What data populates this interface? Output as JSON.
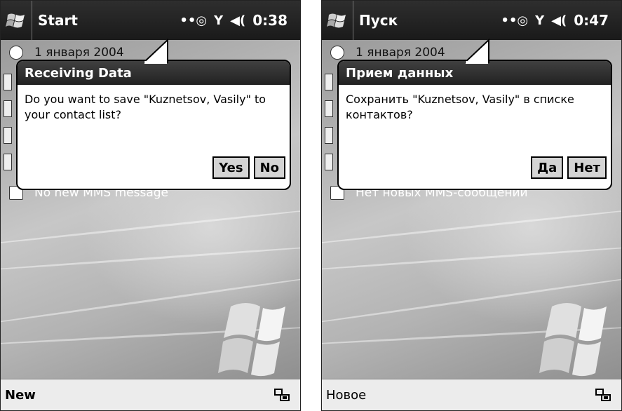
{
  "left": {
    "start_label": "Start",
    "clock": "0:38",
    "date_row": "1 января 2004",
    "mms_row": "No new MMS message",
    "dialog_title": "Receiving Data",
    "dialog_message": "Do you want to save \"Kuznetsov, Vasily\" to your contact list?",
    "yes_label": "Yes",
    "no_label": "No",
    "menu_left": "New"
  },
  "right": {
    "start_label": "Пуск",
    "clock": "0:47",
    "date_row": "1 января 2004",
    "mms_row": "Нет новых MMS-сообщений",
    "dialog_title": "Прием данных",
    "dialog_message": "Сохранить \"Kuznetsov, Vasily\" в списке контактов?",
    "yes_label": "Да",
    "no_label": "Нет",
    "menu_left": "Новое"
  },
  "icons": {
    "start": "windows-flag-icon",
    "connectivity": "connectivity-icon",
    "signal": "signal-antenna-icon",
    "volume": "speaker-volume-icon",
    "input": "keyboard-input-icon"
  }
}
